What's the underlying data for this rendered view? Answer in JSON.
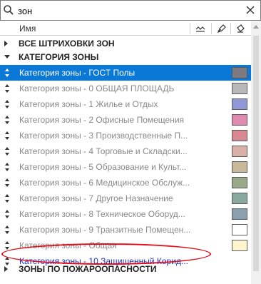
{
  "search": {
    "value": "зон"
  },
  "header": {
    "name_label": "Имя"
  },
  "groups": {
    "all_hatches": "ВСЕ ШТРИХОВКИ ЗОН",
    "zone_category": "КАТЕГОРИЯ ЗОНЫ",
    "fire_hazard": "ЗОНЫ ПО ПОЖАРООПАСНОСТИ"
  },
  "items": [
    {
      "label": "Категория зоны -  ГОСТ Полы",
      "color": "#7a7a80"
    },
    {
      "label": "Категория зоны - 0 ОБЩАЯ ПЛОЩАДЬ",
      "color": "#b8b8b8"
    },
    {
      "label": "Категория зоны - 1 Жилье и Отдых",
      "color": "#9098d8"
    },
    {
      "label": "Категория зоны - 2 Офисные Помещения",
      "color": "#e08ab0"
    },
    {
      "label": "Категория зоны - 3 Производственные П...",
      "color": "#d88890"
    },
    {
      "label": "Категория зоны - 4 Торговые и Складски...",
      "color": "#d8b0a8"
    },
    {
      "label": "Категория зоны - 5 Образование и Культ...",
      "color": "#c8b898"
    },
    {
      "label": "Категория зоны - 6 Медицинское Обслуж...",
      "color": "#98a888"
    },
    {
      "label": "Категория зоны - 7 Другое Назначение",
      "color": "#88a8a0"
    },
    {
      "label": "Категория зоны - 8 Техническое Оборуд...",
      "color": "#8aa0b0"
    },
    {
      "label": "Категория зоны - 9 Транзитные Помещен...",
      "color": "#ffffff"
    },
    {
      "label": "Категория зоны - Общая",
      "color": "#fff4cc"
    },
    {
      "label": "Категория зоны - 10 Защищенный Корид..."
    }
  ]
}
